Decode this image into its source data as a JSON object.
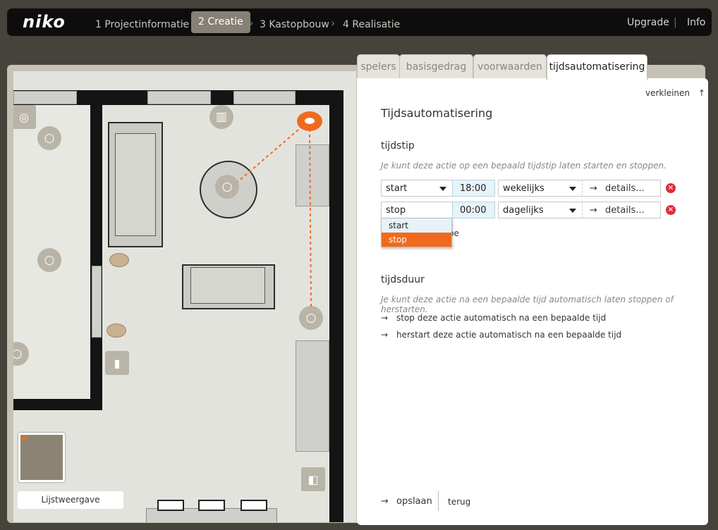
{
  "brand": "niko",
  "nav": {
    "steps": [
      "1 Projectinformatie",
      "2 Creatie",
      "3 Kastopbouw",
      "4 Realisatie"
    ],
    "active_step": "2 Creatie",
    "upgrade": "Upgrade",
    "separator": "|",
    "info": "Info"
  },
  "plan": {
    "list_view_label": "Lijstweergave"
  },
  "tabs": [
    "spelers",
    "basisgedrag",
    "voorwaarden",
    "tijdsautomatisering"
  ],
  "active_tab": "tijdsautomatisering",
  "panel": {
    "collapse_label": "verkleinen",
    "title": "Tijdsautomatisering",
    "tijdstip": {
      "heading": "tijdstip",
      "hint": "Je kunt deze actie op een bepaald tijdstip laten starten en stoppen.",
      "rows": [
        {
          "action": "start",
          "time": "18:00",
          "recurrence": "wekelijks",
          "details": "details..."
        },
        {
          "action": "stop",
          "time": "00:00",
          "recurrence": "dagelijks",
          "details": "details..."
        }
      ],
      "dropdown_options": [
        "start",
        "stop"
      ],
      "dropdown_selected": "stop",
      "add_partial": "p toe"
    },
    "tijdsduur": {
      "heading": "tijdsduur",
      "hint": "Je kunt deze actie na een bepaalde tijd automatisch laten stoppen of herstarten.",
      "link1": "stop deze actie automatisch na een bepaalde tijd",
      "link2": "herstart deze actie automatisch na een bepaalde tijd"
    },
    "save_label": "opslaan",
    "back_label": "terug"
  },
  "colors": {
    "accent": "#f06a1e",
    "delete": "#e32c3c",
    "topbar": "#0d0d0d",
    "time_field": "#e6f3f8"
  },
  "icons": {
    "arrow": "→",
    "collapse": "↑",
    "delete": "×",
    "bulb": "💡"
  }
}
